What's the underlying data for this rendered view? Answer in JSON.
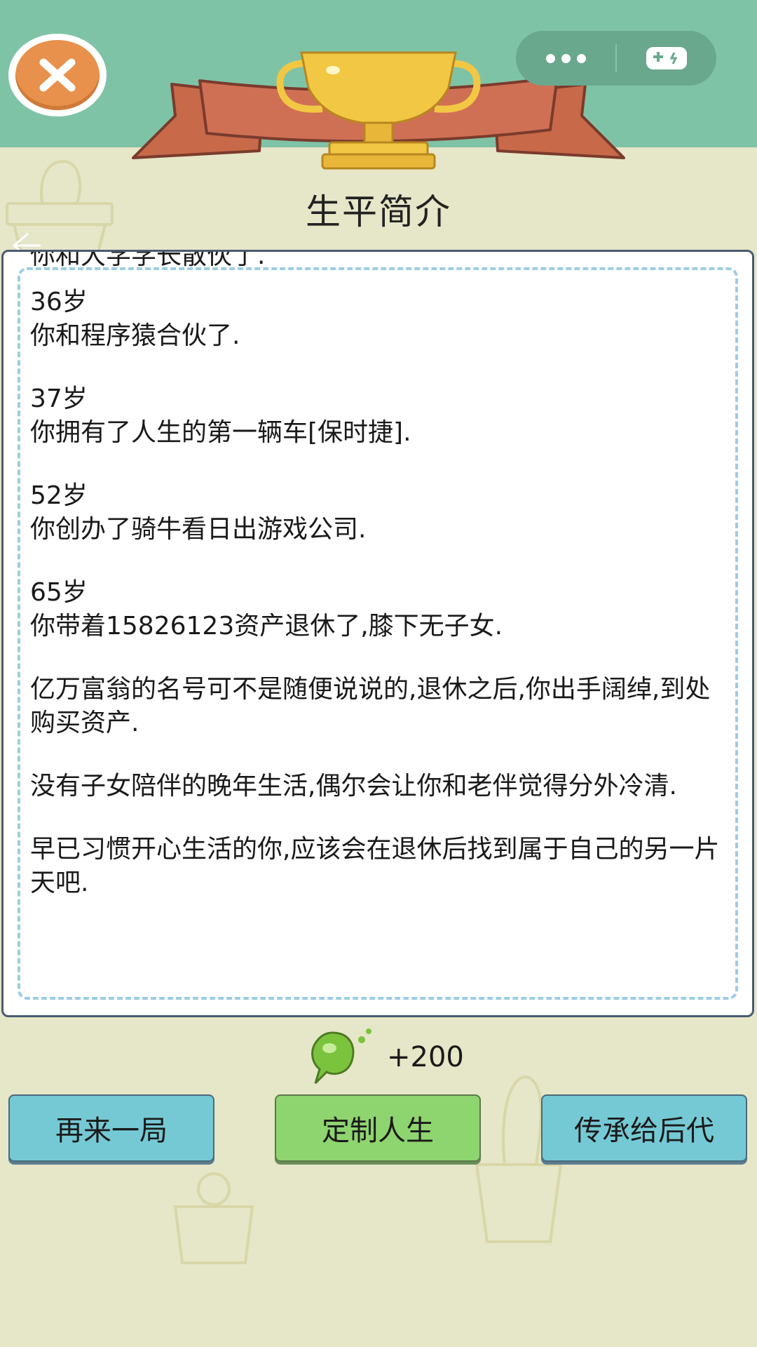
{
  "header": {
    "close_icon": "close-icon",
    "menu_icon": "more-dots-icon",
    "game_icon": "gamepad-icon",
    "trophy_icon": "trophy-icon",
    "title": "生平简介"
  },
  "bio": {
    "partial_line": "你和大学学长散伙了.",
    "entries": [
      {
        "age": "36岁",
        "text": "你和程序猿合伙了."
      },
      {
        "age": "37岁",
        "text": "你拥有了人生的第一辆车[保时捷]."
      },
      {
        "age": "52岁",
        "text": "你创办了骑牛看日出游戏公司."
      },
      {
        "age": "65岁",
        "text": "你带着15826123资产退休了,膝下无子女."
      }
    ],
    "paragraphs": [
      "亿万富翁的名号可不是随便说说的,退休之后,你出手阔绰,到处购买资产.",
      "没有子女陪伴的晚年生活,偶尔会让你和老伴觉得分外冷清.",
      "早已习惯开心生活的你,应该会在退休后找到属于自己的另一片天吧."
    ]
  },
  "reward": {
    "icon": "green-bean-icon",
    "amount": "+200"
  },
  "buttons": {
    "replay": "再来一局",
    "customize": "定制人生",
    "inherit": "传承给后代"
  },
  "colors": {
    "topbar": "#7fc3a6",
    "background": "#e6e6c8",
    "ribbon": "#c8694a",
    "trophy": "#f2c744",
    "button_blue": "#75c9d4",
    "button_green": "#8ed46f",
    "dash_border": "#9ccde3"
  }
}
